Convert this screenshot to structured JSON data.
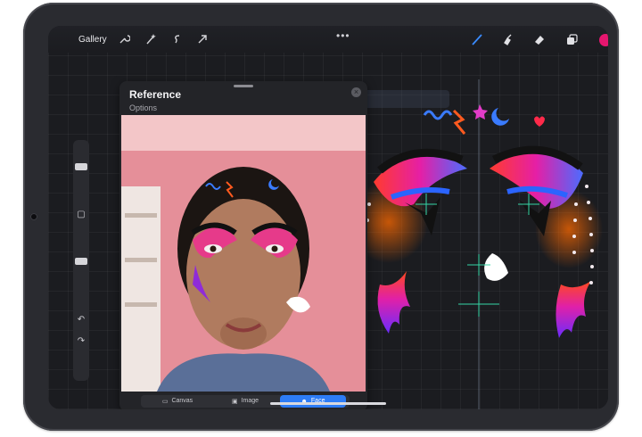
{
  "toolbar": {
    "gallery_label": "Gallery",
    "left_icons": [
      "wrench-icon",
      "magic-wand-icon",
      "selection-icon",
      "transform-arrow-icon"
    ],
    "more_label": "•••",
    "right_icons": [
      "brush-icon",
      "smudge-icon",
      "eraser-icon",
      "layers-icon"
    ],
    "color": "#e6166f"
  },
  "reference": {
    "title": "Reference",
    "subtitle": "Options",
    "tabs": [
      {
        "label": "Canvas",
        "icon": "canvas-icon",
        "active": false
      },
      {
        "label": "Image",
        "icon": "image-icon",
        "active": false
      },
      {
        "label": "Face",
        "icon": "face-icon",
        "active": true
      }
    ]
  },
  "sidebar": {
    "undo_icon": "undo-icon",
    "redo_icon": "redo-icon",
    "modify_icon": "square-icon"
  },
  "colors": {
    "accent": "#2d7cf6",
    "bezel": "#2a2b30",
    "screen": "#1b1c20"
  }
}
